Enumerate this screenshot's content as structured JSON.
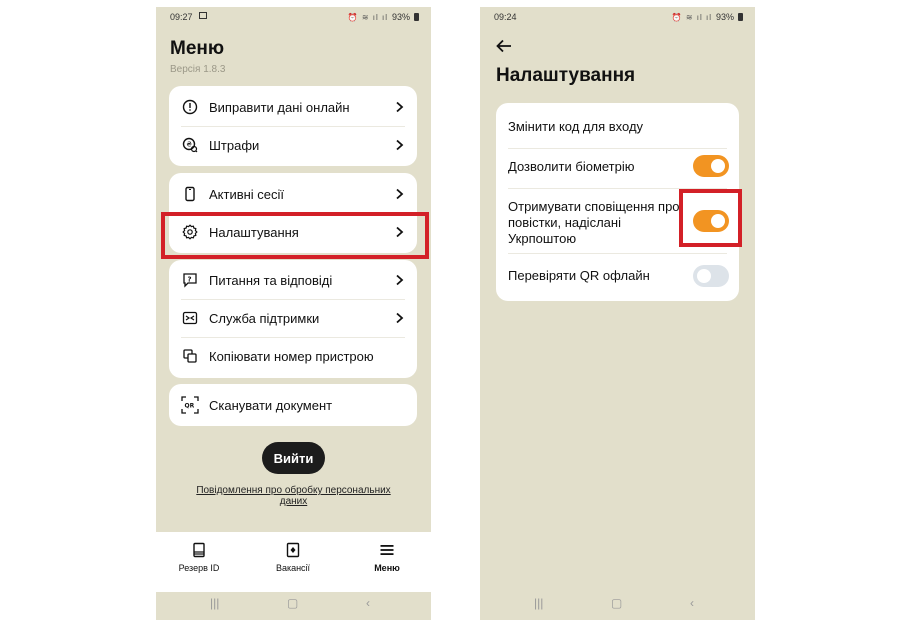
{
  "left": {
    "status": {
      "time": "09:27",
      "battery": "93%"
    },
    "title": "Меню",
    "version": "Версія 1.8.3",
    "groups": [
      {
        "items": [
          {
            "label": "Виправити дані онлайн",
            "icon": "alert-circle-icon"
          },
          {
            "label": "Штрафи",
            "icon": "fine-coin-icon"
          }
        ]
      },
      {
        "items": [
          {
            "label": "Активні сесії",
            "icon": "phone-device-icon"
          },
          {
            "label": "Налаштування",
            "icon": "gear-icon"
          }
        ]
      },
      {
        "items": [
          {
            "label": "Питання та відповіді",
            "icon": "question-bubble-icon"
          },
          {
            "label": "Служба підтримки",
            "icon": "support-icon"
          },
          {
            "label": "Копіювати номер пристрою",
            "icon": "copy-icon"
          }
        ]
      },
      {
        "items": [
          {
            "label": "Сканувати документ",
            "icon": "qr-scan-icon"
          }
        ]
      }
    ],
    "logout": "Вийти",
    "privacy": "Повідомлення про обробку персональних даних",
    "nav": [
      {
        "label": "Резерв ID",
        "icon": "id-card-icon"
      },
      {
        "label": "Вакансії",
        "icon": "vacancy-icon"
      },
      {
        "label": "Меню",
        "icon": "menu-icon"
      }
    ]
  },
  "right": {
    "status": {
      "time": "09:24",
      "battery": "93%"
    },
    "title": "Налаштування",
    "settings": [
      {
        "label": "Змінити код для входу"
      },
      {
        "label": "Дозволити біометрію",
        "toggle": true
      },
      {
        "label": "Отримувати сповіщення про повістки, надіслані Укрпоштою",
        "toggle": true
      },
      {
        "label": "Перевіряти QR офлайн",
        "toggle": false
      }
    ]
  },
  "colors": {
    "background": "#e2dfcb",
    "accent": "#f29422",
    "highlight": "#d32027"
  }
}
